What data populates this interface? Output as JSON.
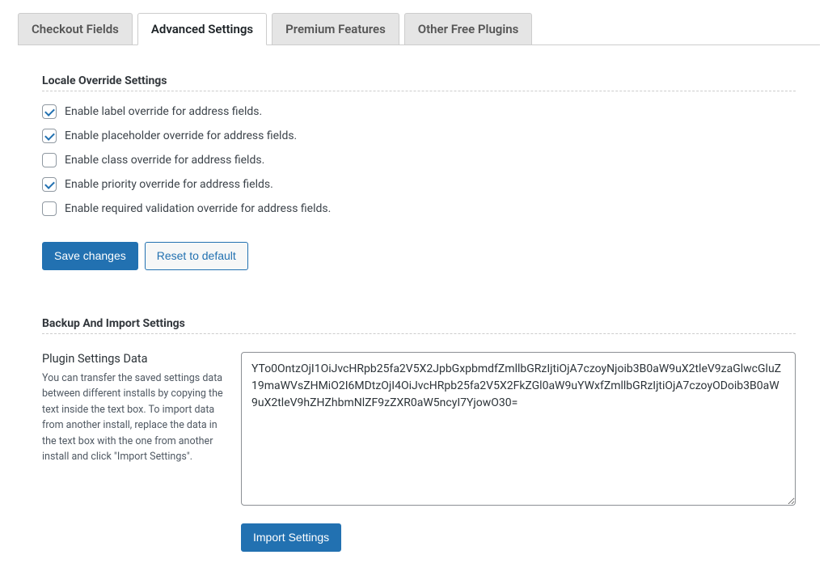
{
  "tabs": {
    "checkout_fields": "Checkout Fields",
    "advanced_settings": "Advanced Settings",
    "premium_features": "Premium Features",
    "other_free_plugins": "Other Free Plugins"
  },
  "active_tab": "advanced_settings",
  "locale_section": {
    "title": "Locale Override Settings",
    "options": [
      {
        "label": "Enable label override for address fields.",
        "checked": true
      },
      {
        "label": "Enable placeholder override for address fields.",
        "checked": true
      },
      {
        "label": "Enable class override for address fields.",
        "checked": false
      },
      {
        "label": "Enable priority override for address fields.",
        "checked": true
      },
      {
        "label": "Enable required validation override for address fields.",
        "checked": false
      }
    ]
  },
  "buttons": {
    "save": "Save changes",
    "reset": "Reset to default"
  },
  "backup_section": {
    "title": "Backup And Import Settings",
    "data_heading": "Plugin Settings Data",
    "description": "You can transfer the saved settings data between different installs by copying the text inside the text box. To import data from another install, replace the data in the text box with the one from another install and click \"Import Settings\".",
    "textarea_value": "YTo0OntzOjI1OiJvcHRpb25fa2V5X2JpbGxpbmdfZmllbGRzIjtiOjA7czoyNjoib3B0aW9uX2tleV9zaGlwcGluZ19maWVsZHMiO2I6MDtzOjI4OiJvcHRpb25fa2V5X2FkZGl0aW9uYWxfZmllbGRzIjtiOjA7czoyODoib3B0aW9uX2tleV9hZHZhbmNlZF9zZXR0aW5ncyI7YjowO30=",
    "import_button": "Import Settings"
  }
}
